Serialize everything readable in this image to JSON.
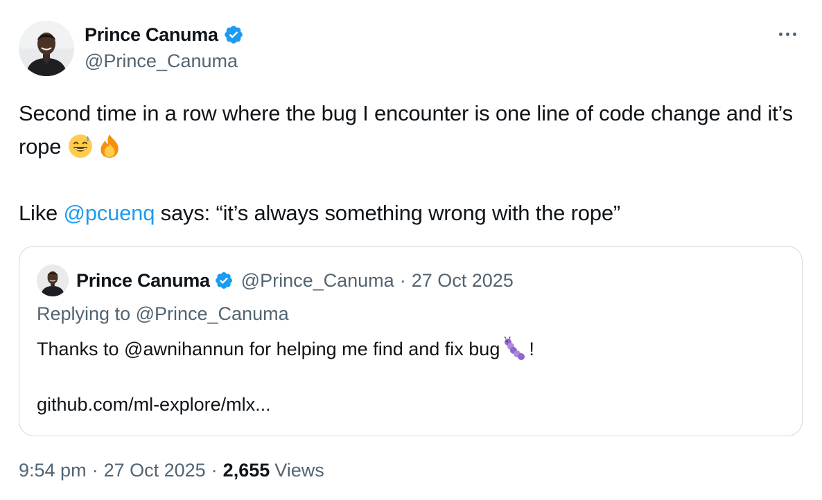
{
  "author": {
    "display_name": "Prince Canuma",
    "handle": "@Prince_Canuma"
  },
  "tweet": {
    "line1_text": "Second time in a row where the bug I encounter is one line of code change and it’s rope ",
    "emoji_1": "sweat-smile-emoji",
    "emoji_2": "fire-emoji",
    "line2_prefix": "Like ",
    "line2_mention": "@pcuenq",
    "line2_suffix": " says: “it’s always something wrong with the rope”"
  },
  "quote": {
    "display_name": "Prince Canuma",
    "handle": "@Prince_Canuma",
    "separator": "·",
    "date": "27 Oct 2025",
    "replying_to": "Replying to @Prince_Canuma",
    "text_before": "Thanks to @awnihannun for helping me find and fix bug",
    "text_emoji": "bug-emoji",
    "text_after": "!",
    "link": "github.com/ml-explore/mlx..."
  },
  "meta": {
    "time": "9:54 pm",
    "sep1": "·",
    "date": "27 Oct 2025",
    "sep2": "·",
    "views_count": "2,655",
    "views_label": "Views"
  },
  "colors": {
    "accent": "#1d9bf0",
    "muted": "#536471",
    "text": "#0f1419",
    "border": "#cfd9de"
  },
  "icons": {
    "verified": "verified-badge-icon",
    "more": "more-options-icon"
  }
}
